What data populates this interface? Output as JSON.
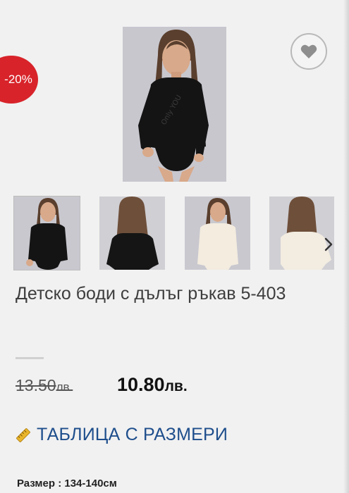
{
  "badge": {
    "discount": "-20%"
  },
  "product": {
    "title": "Детско боди с дълъг ръкав 5-403",
    "old_price": "13.50",
    "old_currency": "лв.",
    "new_price": "10.80",
    "new_currency": "лв."
  },
  "links": {
    "size_table": "ТАБЛИЦА С РАЗМЕРИ"
  },
  "size": {
    "label": "Размер",
    "separator": ":",
    "value": "134-140см"
  },
  "watermark": "Only YOU",
  "icons": {
    "wishlist": "heart-icon",
    "next": "chevron-right-icon",
    "size_table": "ruler-icon"
  },
  "colors": {
    "badge": "#d8232a",
    "link": "#1e4e8c",
    "background": "#f1f1f1"
  }
}
